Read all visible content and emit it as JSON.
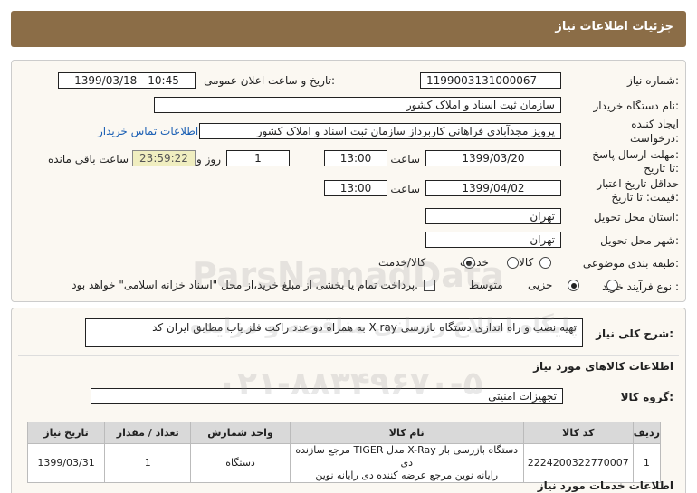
{
  "header": {
    "title": "جزئیات اطلاعات نیاز"
  },
  "form": {
    "need_number_label": "شماره نیاز:",
    "need_number": "1199003131000067",
    "announce_label": "تاریخ و ساعت اعلان عمومی:",
    "announce_value": "1399/03/18 - 10:45",
    "buyer_label": "نام دستگاه خریدار:",
    "buyer_value": "سازمان ثبت اسناد و املاک کشور",
    "creator_label_1": "ایجاد کننده",
    "creator_label_2": "درخواست:",
    "creator_value": "پرویز  مجدآبادی فراهانی کاربرداز سازمان ثبت اسناد و املاک کشور",
    "contact_link": "اطلاعات تماس خریدار",
    "deadline_label_1": "مهلت ارسال پاسخ:",
    "deadline_label_2": "تا تاریخ:",
    "deadline_date": "1399/03/20",
    "time_label": "ساعت",
    "deadline_time": "13:00",
    "days_value": "1",
    "days_label": "روز و",
    "remaining_time": "23:59:22",
    "remaining_label": "ساعت باقی مانده",
    "validity_label_1": "حداقل تاریخ اعتبار",
    "validity_label_2": "قیمت: تا تاریخ:",
    "validity_date": "1399/04/02",
    "validity_time": "13:00",
    "province_label": "استان محل تحویل:",
    "province_value": "تهران",
    "city_label": "شهر محل تحویل:",
    "city_value": "تهران",
    "category_label": "طبقه بندی موضوعی:",
    "category_options": [
      "کالا",
      "خدمت",
      "کالا/خدمت"
    ],
    "category_selected": "کالا/خدمت",
    "process_label": "نوع فرآیند خرید :",
    "process_options": [
      "جزیی",
      "متوسط"
    ],
    "process_selected": "متوسط",
    "payment_note": "پرداخت تمام یا بخشی از مبلغ خرید،از محل \"اسناد خزانه اسلامی\" خواهد بود."
  },
  "details": {
    "description_label": "شرح کلی نیاز:",
    "description_value": "تهیه نصب و راه اندازی دستگاه بازرسی  X ray  به همراه دو عدد راکت فلز یاب مطابق ایران کد",
    "goods_info_title": "اطلاعات کالاهای مورد نیاز",
    "goods_group_label": "گروه کالا:",
    "goods_group_value": "تجهیزات امنیتی",
    "services_info_title": "اطلاعات خدمات مورد نیاز"
  },
  "table": {
    "headers": [
      "ردیف",
      "کد کالا",
      "نام کالا",
      "واحد شمارش",
      "تعداد / مقدار",
      "تاریخ نیاز"
    ],
    "rows": [
      {
        "row": "1",
        "code": "2224200322770007",
        "name_line1": "دستگاه بازرسی بار X-Ray مدل TIGER مرجع سازنده دی",
        "name_line2": "رایانه نوین مرجع عرضه کننده دی رایانه نوین",
        "unit": "دستگاه",
        "qty": "1",
        "date": "1399/03/31"
      }
    ]
  },
  "watermark": {
    "brand": "ParsNamadData",
    "line1": "پایگاه اطلاع رسانی مناقصه و مزایده",
    "phone": "۰۲۱-۸۸۳۴۹۶۷۰-۵"
  }
}
